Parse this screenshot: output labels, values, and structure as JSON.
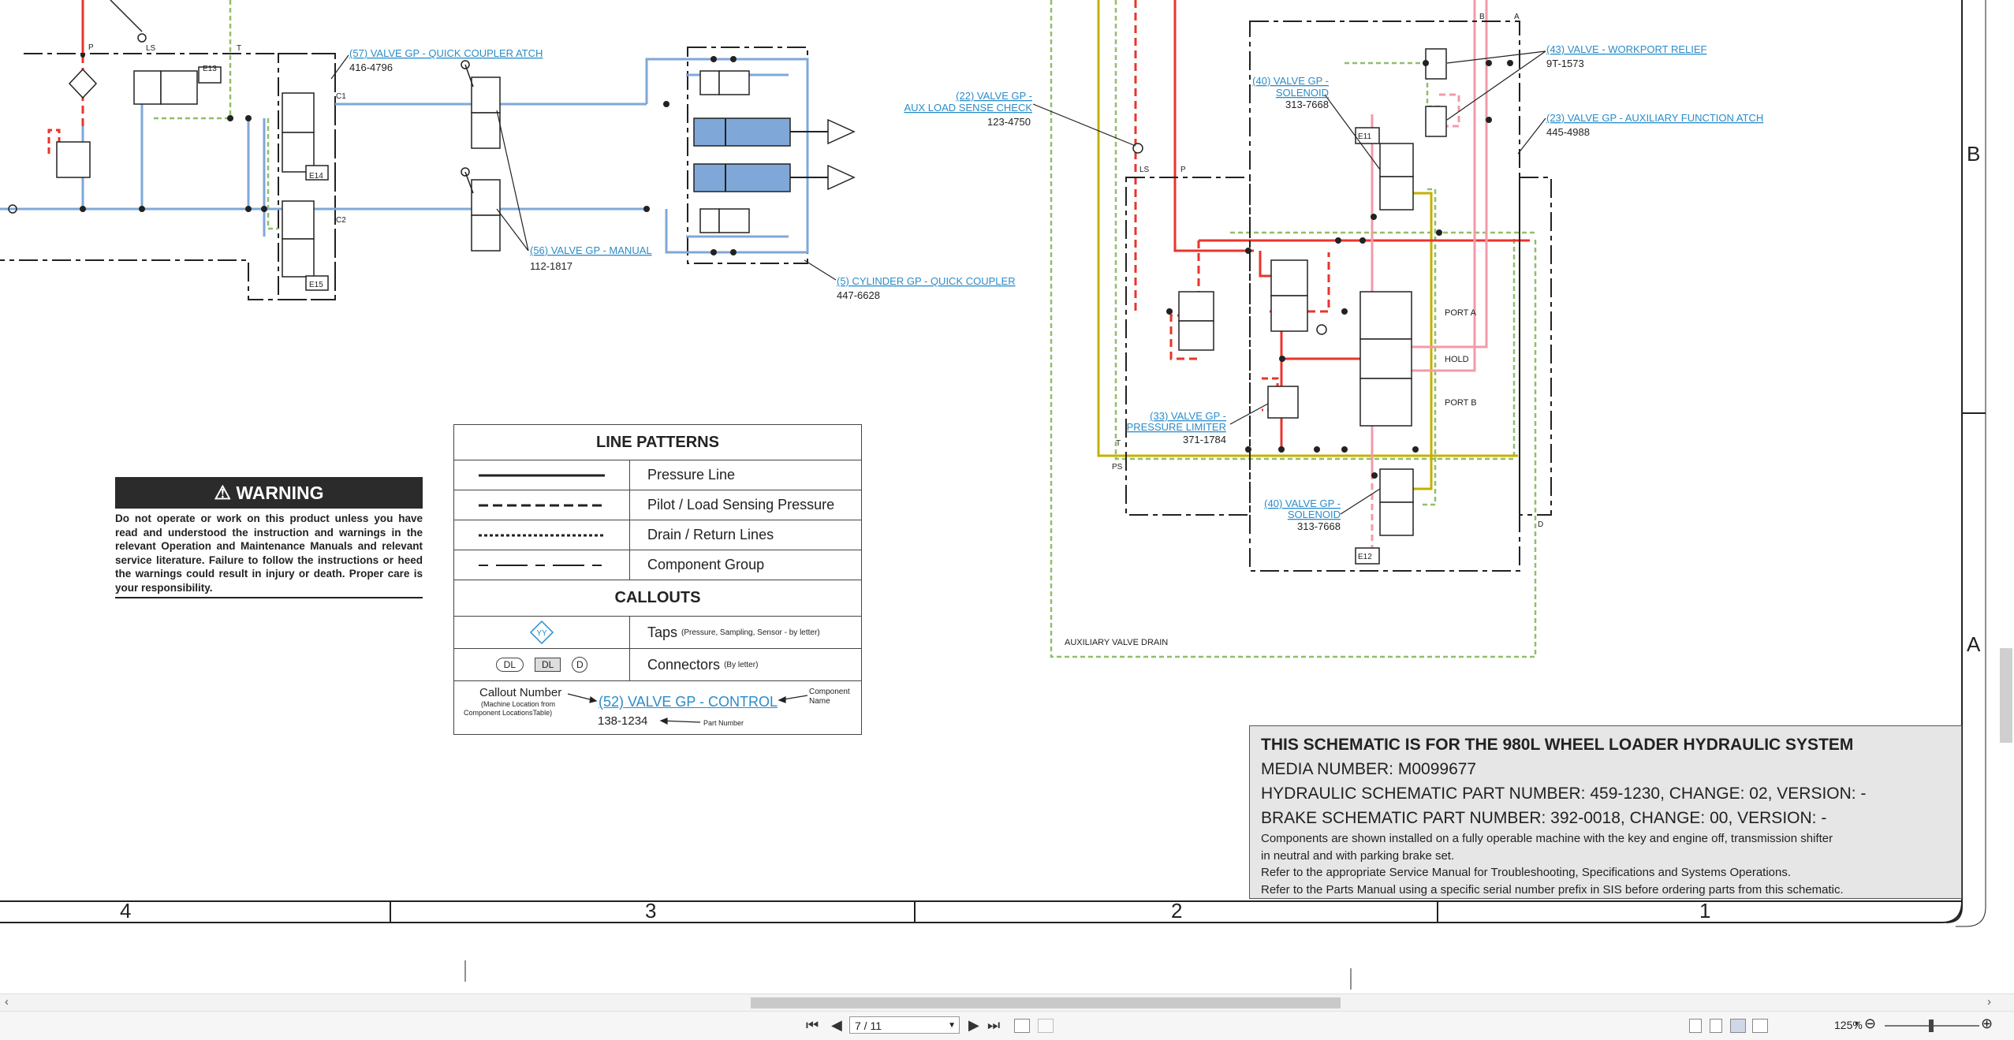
{
  "callouts": {
    "c57": {
      "label": "(57) VALVE GP - QUICK COUPLER ATCH",
      "pn": "416-4796"
    },
    "c56": {
      "label": "(56) VALVE GP - MANUAL",
      "pn": "112-1817"
    },
    "c5": {
      "label": "(5) CYLINDER GP - QUICK COUPLER",
      "pn": "447-6628"
    },
    "c22": {
      "label1": "(22) VALVE GP -",
      "label2": "AUX LOAD SENSE CHECK",
      "pn": "123-4750"
    },
    "c40a": {
      "label1": "(40) VALVE GP -",
      "label2": "SOLENOID",
      "pn": "313-7668"
    },
    "c43": {
      "label": "(43) VALVE - WORKPORT RELIEF",
      "pn": "9T-1573"
    },
    "c23": {
      "label": "(23) VALVE GP - AUXILIARY FUNCTION ATCH",
      "pn": "445-4988"
    },
    "c33": {
      "label1": "(33) VALVE GP -",
      "label2": "PRESSURE LIMITER",
      "pn": "371-1784"
    },
    "c40b": {
      "label1": "(40) VALVE GP -",
      "label2": "SOLENOID",
      "pn": "313-7668"
    }
  },
  "schematic_labels": {
    "e13": "E13",
    "e14": "E14",
    "e15": "E15",
    "e11": "E11",
    "e12": "E12",
    "c1": "C1",
    "c2": "C2",
    "p": "P",
    "ls": "LS",
    "t": "T",
    "ls2": "LS",
    "p2": "P",
    "a": "A",
    "b": "B",
    "d": "D",
    "ps": "PS",
    "t2": "T",
    "port_a": "PORT A",
    "hold": "HOLD",
    "port_b": "PORT B",
    "aux_drain": "AUXILIARY VALVE DRAIN"
  },
  "legend": {
    "title_lines": "LINE PATTERNS",
    "lines": [
      "Pressure Line",
      "Pilot / Load Sensing Pressure",
      "Drain / Return Lines",
      "Component Group"
    ],
    "title_callouts": "CALLOUTS",
    "taps_label": "Taps",
    "taps_note": "(Pressure, Sampling, Sensor - by letter)",
    "taps_symbol": "YY",
    "connectors_label": "Connectors",
    "connectors_note": "(By letter)",
    "conn_sym1": "DL",
    "conn_sym2": "DL",
    "conn_sym3": "D",
    "sample_callout_number": "Callout Number",
    "sample_location_note1": "(Machine Location from",
    "sample_location_note2": "Component LocationsTable)",
    "sample_link": "(52) VALVE GP - CONTROL",
    "sample_component_name1": "Component",
    "sample_component_name2": "Name",
    "sample_pn": "138-1234",
    "sample_part_number": "Part Number"
  },
  "warning": {
    "title": "WARNING",
    "text": "Do not operate or work on this product unless you have read and understood the instruction and warnings in the relevant Operation and Maintenance Manuals and relevant service literature. Failure to follow the instructions or heed the warnings could result in injury or death. Proper care is your responsibility."
  },
  "info": {
    "line1": "THIS SCHEMATIC IS FOR THE 980L WHEEL LOADER HYDRAULIC SYSTEM",
    "line2": "MEDIA NUMBER: M0099677",
    "line3": "HYDRAULIC SCHEMATIC PART NUMBER: 459-1230, CHANGE: 02, VERSION: -",
    "line4": "BRAKE SCHEMATIC PART NUMBER: 392-0018, CHANGE: 00, VERSION: -",
    "line5": "Components are shown installed on a fully operable machine with the key and engine off, transmission shifter",
    "line6": "in neutral and with parking brake set.",
    "line7": "Refer to the appropriate Service Manual for Troubleshooting, Specifications and Systems Operations.",
    "line8": "Refer to the Parts Manual using a specific serial number prefix in SIS before ordering parts from this schematic."
  },
  "grid": {
    "cols": [
      "4",
      "3",
      "2",
      "1"
    ],
    "rows": [
      "B",
      "A"
    ]
  },
  "toolbar": {
    "page": "7 / 11",
    "zoom": "125%",
    "first": "⏮",
    "prev": "◀",
    "next": "▶",
    "last": "⏭"
  },
  "colors": {
    "pressure": "#e8342c",
    "pilot": "#e8342c",
    "return": "#8fbf6a",
    "aux": "#c4b000",
    "blue": "#7fa8d8",
    "pink": "#f39aa8",
    "link": "#2a8cc9"
  }
}
